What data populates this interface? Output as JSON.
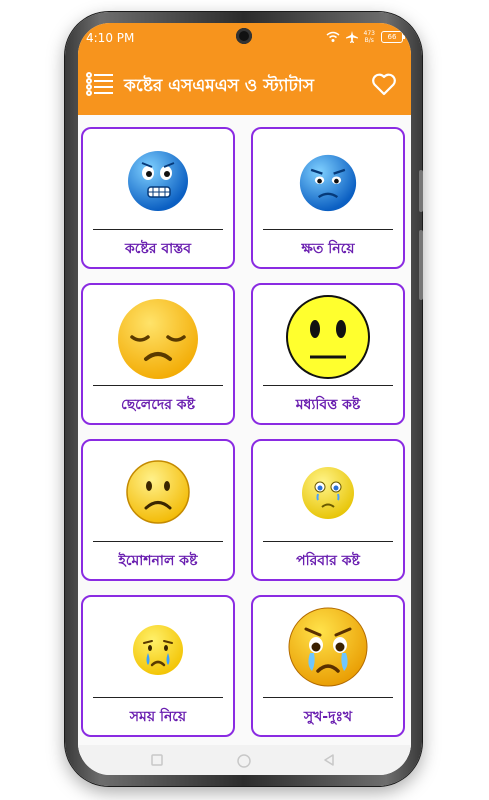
{
  "status_bar": {
    "time": "4:10 PM",
    "speed_value": "473",
    "speed_unit": "B/s",
    "battery": "66"
  },
  "app_bar": {
    "title": "কষ্টের এসএমএস ও স্ট্যাটাস",
    "menu_icon": "list-menu-icon",
    "favorite_icon": "heart-outline-icon"
  },
  "colors": {
    "accent": "#f7941d",
    "card_border": "#8a2be2",
    "label_text": "#6a1fb0"
  },
  "categories": [
    {
      "label": "কষ্টের বাস্তব",
      "icon": "grimacing-blue-face-icon"
    },
    {
      "label": "ক্ষত নিয়ে",
      "icon": "worried-blue-face-icon"
    },
    {
      "label": "ছেলেদের কষ্ট",
      "icon": "disappointed-face-icon"
    },
    {
      "label": "মধ্যবিত্ত কষ্ট",
      "icon": "neutral-face-icon"
    },
    {
      "label": "ইমোশনাল কষ্ট",
      "icon": "frowning-face-icon"
    },
    {
      "label": "পরিবার কষ্ট",
      "icon": "teary-face-icon"
    },
    {
      "label": "সময় নিয়ে",
      "icon": "crying-face-icon"
    },
    {
      "label": "সুখ-দুঃখ",
      "icon": "sobbing-face-icon"
    }
  ]
}
